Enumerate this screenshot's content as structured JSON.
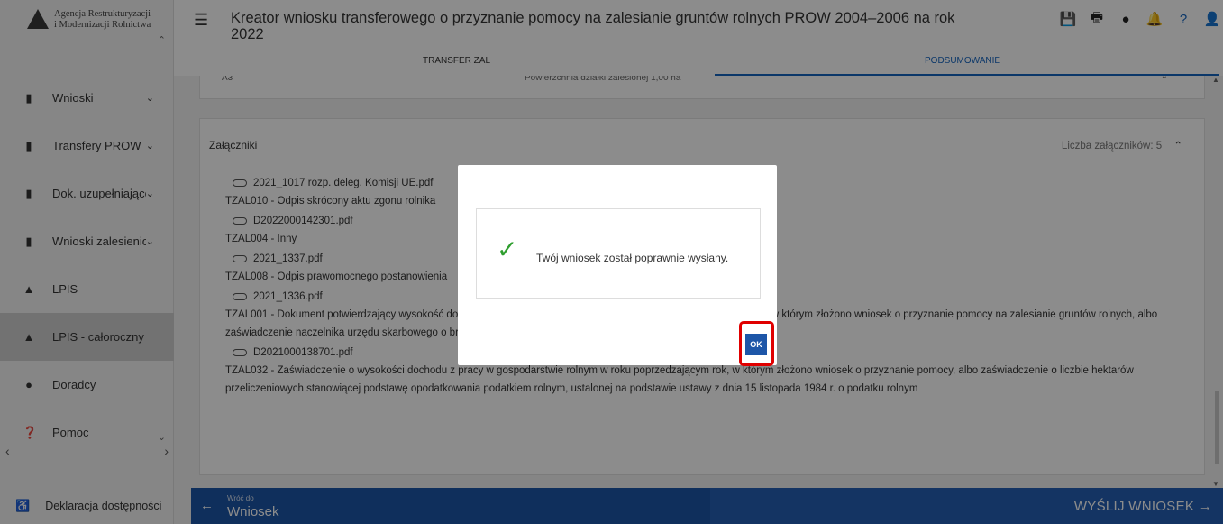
{
  "brand": {
    "line1": "Agencja Restrukturyzacji",
    "line2": "i Modernizacji Rolnictwa"
  },
  "sidebar": {
    "items": [
      {
        "icon": "document-icon",
        "label": "Wnioski",
        "chevron": "⌄"
      },
      {
        "icon": "document-icon",
        "label": "Transfery PROW",
        "chevron": "⌄"
      },
      {
        "icon": "document-icon",
        "label": "Dok. uzupełniające",
        "chevron": "⌄"
      },
      {
        "icon": "document-icon",
        "label": "Wnioski zalesieniowe",
        "chevron": "⌄"
      },
      {
        "icon": "mountain-icon",
        "label": "LPIS",
        "chevron": ""
      },
      {
        "icon": "mountain-icon",
        "label": "LPIS - całoroczny",
        "chevron": ""
      },
      {
        "icon": "person-icon",
        "label": "Doradcy",
        "chevron": ""
      },
      {
        "icon": "help-circle-icon",
        "label": "Pomoc",
        "chevron": ""
      }
    ],
    "active_index": 5,
    "declaration": "Deklaracja dostępności"
  },
  "header": {
    "title": "Kreator wniosku transferowego o przyznanie pomocy na zalesianie gruntów rolnych PROW 2004–2006 na rok 2022",
    "icons": [
      "save-icon",
      "print-icon",
      "alert-icon",
      "bell-icon",
      "help-icon",
      "user-icon"
    ]
  },
  "tabs": {
    "first": "TRANSFER ZAL",
    "second": "PODSUMOWANIE"
  },
  "top_card": {
    "code": "A3",
    "text": "Powierzchnia działki zalesionej 1,00 ha"
  },
  "attachments": {
    "title": "Załączniki",
    "count_label": "Liczba załączników: 5",
    "items": [
      {
        "file": "2021_1017 rozp. deleg. Komisji UE.pdf",
        "desc": "TZAL010 - Odpis skrócony aktu zgonu rolnika"
      },
      {
        "file": "D2022000142301.pdf",
        "desc": "TZAL004 - Inny"
      },
      {
        "file": "2021_1337.pdf",
        "desc": "TZAL008 - Odpis prawomocnego postanowienia"
      },
      {
        "file": "2021_1336.pdf",
        "desc": "TZAL001 - Dokument potwierdzający wysokość dochodu z pracy w gospodarstwie rolnym w roku poprzedzającym rok, w którym złożono wniosek o przyznanie pomocy na zalesianie gruntów rolnych, albo zaświadczenie naczelnika urzędu skarbowego o braku tych dochodów"
      },
      {
        "file": "D2021000138701.pdf",
        "desc": "TZAL032 - Zaświadczenie o wysokości dochodu z pracy w gospodarstwie rolnym w roku poprzedzającym rok, w którym złożono wniosek o przyznanie pomocy, albo zaświadczenie o liczbie hektarów przeliczeniowych stanowiącej podstawę opodatkowania podatkiem rolnym, ustalonej na podstawie ustawy z dnia 15 listopada 1984 r. o podatku rolnym"
      }
    ]
  },
  "footer": {
    "back_small": "Wróć do",
    "back_big": "Wniosek",
    "send": "WYŚLIJ WNIOSEK"
  },
  "modal": {
    "message": "Twój wniosek został poprawnie wysłany.",
    "ok_label": "OK"
  },
  "colors": {
    "primary": "#1d56a8",
    "success": "#2e9e2e",
    "highlight": "#e00000"
  }
}
